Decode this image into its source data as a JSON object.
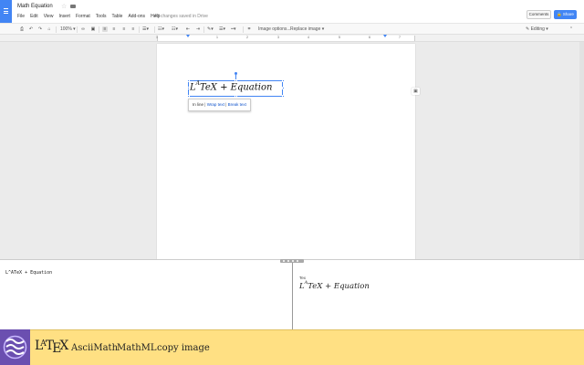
{
  "doc": {
    "title": "Math Equation",
    "star": "☆",
    "menu": [
      "File",
      "Edit",
      "View",
      "Insert",
      "Format",
      "Tools",
      "Table",
      "Add-ons",
      "Help"
    ],
    "saved_status": "All changes saved in Drive",
    "comments_label": "Comments",
    "share_label": "Share"
  },
  "toolbar": {
    "zoom": "100%",
    "image_options": "Image options...",
    "replace_image": "Replace image ▾",
    "mode": "Editing"
  },
  "ruler": {
    "labels": [
      "1",
      "1",
      "2",
      "3",
      "4",
      "5",
      "6",
      "7"
    ]
  },
  "image": {
    "equation_text": "LATeX + Equation",
    "options": [
      "In line",
      "Wrap text",
      "Break text"
    ],
    "separator": "|"
  },
  "panel": {
    "source": "L^ATeX + Equation",
    "preview_label": "Tex",
    "preview_equation": "LATeX + Equation"
  },
  "bottombar": {
    "latex_logo": "LaTeX",
    "links": [
      "AsciiMath",
      "MathML",
      "copy image"
    ],
    "colors": {
      "background": "#ffe083",
      "logo": "#6b4fb0"
    }
  }
}
